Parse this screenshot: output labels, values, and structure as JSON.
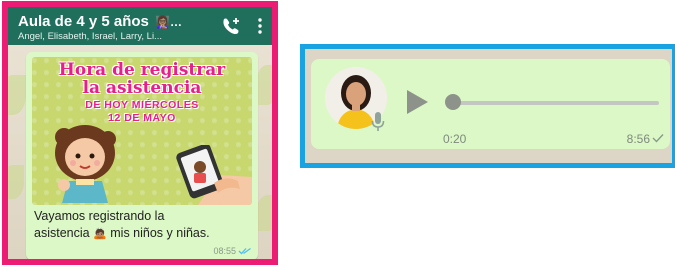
{
  "chat": {
    "title": "Aula de 4 y 5 años",
    "title_emoji": "👩🏽‍🏫…",
    "members": "Angel, Elisabeth, Israel, Larry, Li...",
    "poster": {
      "title_line1": "Hora de registrar",
      "title_line2": "la asistencia",
      "day": "DE HOY MIÉRCOLES",
      "date": "12 DE MAYO"
    },
    "message": {
      "text_part1": "Vayamos registrando la",
      "text_part2": "asistencia",
      "emoji": "🙇🏽",
      "text_part3": " mis niños y niñas.",
      "time": "08:55"
    }
  },
  "voice_note": {
    "elapsed": "0:20",
    "time": "8:56",
    "progress": 0.0
  },
  "colors": {
    "left_frame": "#ec1c74",
    "right_frame": "#1aa3e2",
    "header": "#1f6f5c",
    "bubble": "#dcf8c6"
  }
}
